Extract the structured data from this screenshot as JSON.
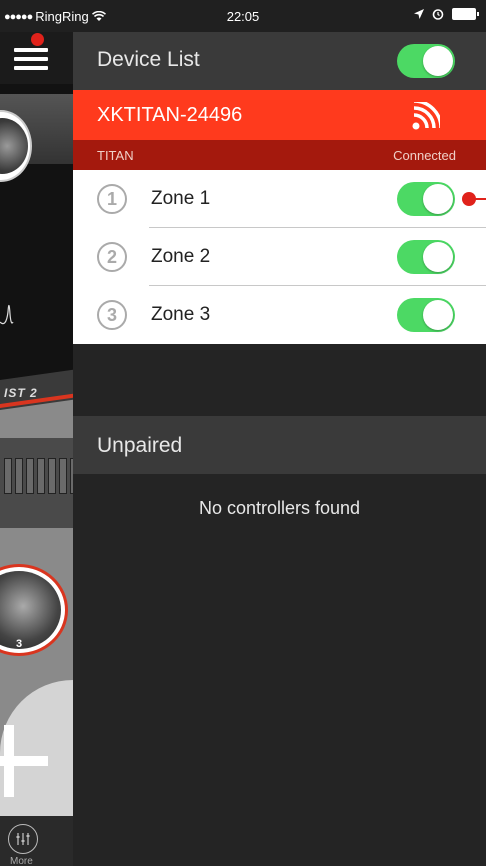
{
  "status_bar": {
    "signal": "●●●●●",
    "carrier": "RingRing",
    "time": "22:05"
  },
  "header": {
    "title": "Device List",
    "toggle_on": true
  },
  "device": {
    "name": "XKTITAN-24496",
    "model": "TITAN",
    "status": "Connected"
  },
  "zones": [
    {
      "number": "1",
      "label": "Zone 1",
      "on": true
    },
    {
      "number": "2",
      "label": "Zone 2",
      "on": true
    },
    {
      "number": "3",
      "label": "Zone 3",
      "on": true
    }
  ],
  "unpaired": {
    "title": "Unpaired",
    "empty_message": "No controllers found"
  },
  "sidebar": {
    "more_label": "More",
    "preset_label": "IST 2",
    "preset_number": "3"
  },
  "colors": {
    "accent_red": "#ff3a1d",
    "dark_red": "#a4190d",
    "toggle_green": "#4cd964"
  },
  "icons": {
    "menu": "hamburger-icon",
    "wifi": "wifi-signal-icon",
    "more": "mixer-icon",
    "add": "plus-icon"
  }
}
